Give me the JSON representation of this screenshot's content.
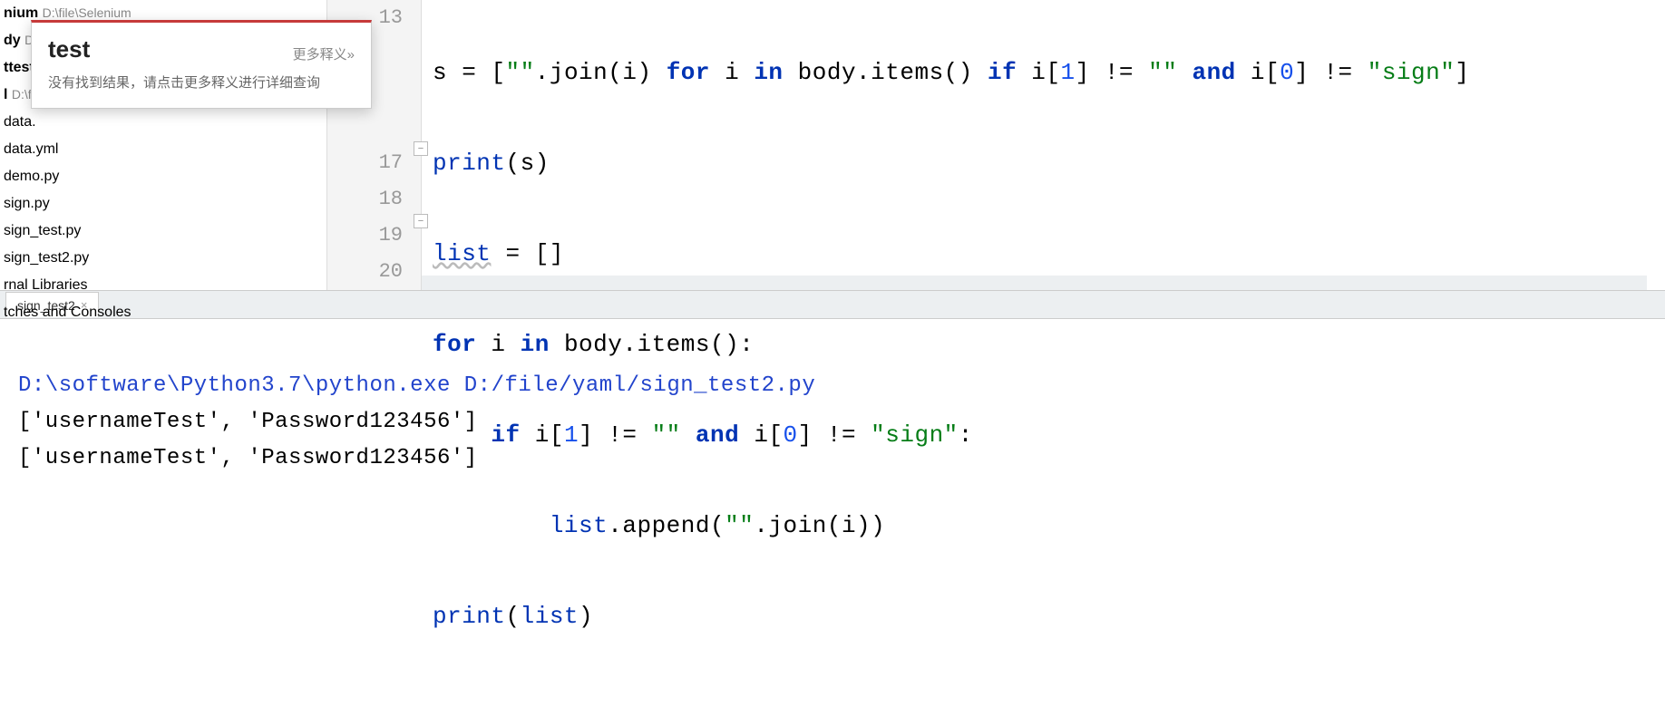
{
  "sidebar": {
    "items": [
      {
        "label": "nium",
        "path": "D:\\file\\Selenium",
        "bold": true
      },
      {
        "label": "dy",
        "path": "D:\\file\\Study",
        "bold": true
      },
      {
        "label": "ttest",
        "path": "",
        "bold": true
      },
      {
        "label": "l",
        "path": "D:\\file\\yaml",
        "bold": true
      },
      {
        "label": "data.",
        "path": "",
        "bold": false
      },
      {
        "label": "data.yml",
        "path": "",
        "bold": false
      },
      {
        "label": "demo.py",
        "path": "",
        "bold": false
      },
      {
        "label": "sign.py",
        "path": "",
        "bold": false
      },
      {
        "label": "sign_test.py",
        "path": "",
        "bold": false
      },
      {
        "label": "sign_test2.py",
        "path": "",
        "bold": false
      },
      {
        "label": "rnal Libraries",
        "path": "",
        "bold": false
      },
      {
        "label": "tches and Consoles",
        "path": "",
        "bold": false
      }
    ]
  },
  "popup": {
    "title": "test",
    "more": "更多释义»",
    "body": "没有找到结果，请点击更多释义进行详细查询"
  },
  "gutter": {
    "lines": [
      "13",
      "",
      "",
      "",
      "17",
      "18",
      "19",
      "20"
    ]
  },
  "code": {
    "line1": {
      "pre": "s = [",
      "str1": "\"\"",
      "dot": ".",
      "join": "join",
      "p1": "(i) ",
      "for": "for",
      "sp1": " i ",
      "in": "in",
      "sp2": " body.",
      "items": "items",
      "p2": "() ",
      "if": "if",
      "sp3": " i[",
      "n1": "1",
      "br1": "] != ",
      "str2": "\"\"",
      "and": " and ",
      "sp4": "i[",
      "n0": "0",
      "br2": "] != ",
      "str3": "\"sign\"",
      "end": "]"
    },
    "line2": {
      "print": "print",
      "args": "(s)"
    },
    "line3": {
      "list": "list",
      "rest": " = []"
    },
    "line4": {
      "for": "for",
      "sp1": " i ",
      "in": "in",
      "sp2": " body.",
      "items": "items",
      "end": "():"
    },
    "line5": {
      "indent": "    ",
      "if": "if",
      "sp": " i[",
      "n1": "1",
      "m1": "] != ",
      "s1": "\"\"",
      "and": " and ",
      "sp2": "i[",
      "n0": "0",
      "m2": "] != ",
      "s2": "\"sign\"",
      "end": ":"
    },
    "line6": {
      "indent": "        ",
      "list": "list",
      "dot": ".",
      "append": "append",
      "p1": "(",
      "s1": "\"\"",
      "dot2": ".",
      "join": "join",
      "end": "(i))"
    },
    "line7": {
      "print": "print",
      "p1": "(",
      "list": "list",
      "end": ")"
    }
  },
  "tab": {
    "label": "sign_test2",
    "close": "×"
  },
  "console": {
    "cmd": "D:\\software\\Python3.7\\python.exe D:/file/yaml/sign_test2.py",
    "out1": "['usernameTest', 'Password123456']",
    "out2": "['usernameTest', 'Password123456']"
  }
}
